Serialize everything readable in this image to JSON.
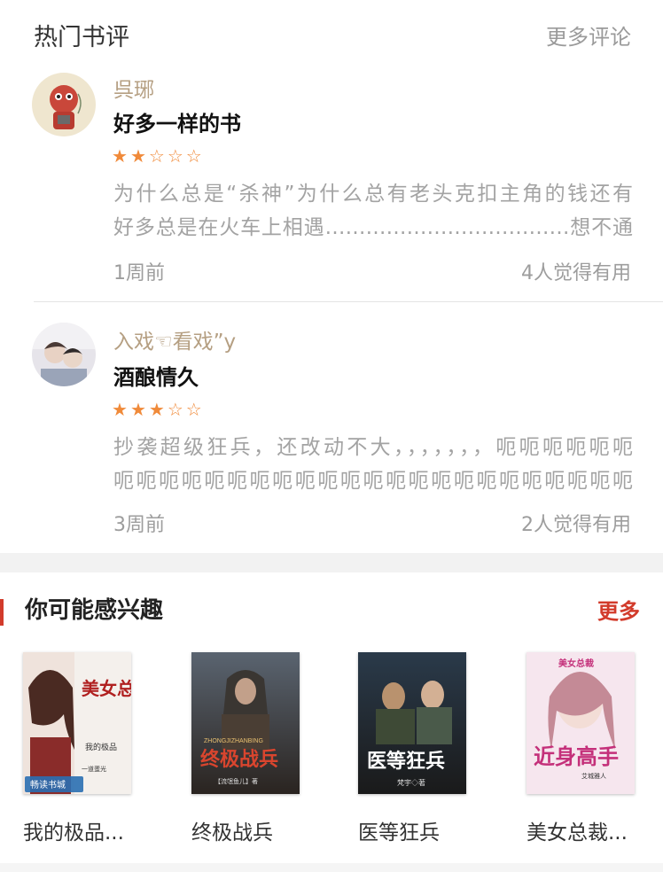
{
  "reviews_section": {
    "title": "热门书评",
    "more_label": "更多评论",
    "items": [
      {
        "username": "呉琊",
        "book": "好多一样的书",
        "rating": 2,
        "max_rating": 5,
        "text_lines": [
          "为什么总是“杀神”为什么总有老头克扣主角的钱还有",
          "好多总是在火车上相遇………………………………想不通"
        ],
        "time": "1周前",
        "helpful": "4人觉得有用"
      },
      {
        "username": "入戏☜看戏”y",
        "book": "酒酿情久",
        "rating": 3,
        "max_rating": 5,
        "text_lines": [
          "抄袭超级狂兵，还改动不大，，，，，，，呃呃呃呃呃呃",
          "呃呃呃呃呃呃呃呃呃呃呃呃呃呃呃呃呃呃呃呃呃呃呃"
        ],
        "time": "3周前",
        "helpful": "2人觉得有用"
      }
    ]
  },
  "recommend_section": {
    "title": "你可能感兴趣",
    "more_label": "更多",
    "books": [
      {
        "title": "我的极品...",
        "cover_text": "美女总裁",
        "cover_sub": "我的极品",
        "cover_badge": "畅读书城",
        "cover_author": "一道蛋光"
      },
      {
        "title": "终极战兵",
        "cover_text": "终极战兵",
        "cover_sub": "ZHONGJIZHANBING",
        "cover_author": "【流氓鱼儿】著"
      },
      {
        "title": "医等狂兵",
        "cover_text": "医等狂兵",
        "cover_author": "梵宇◇著"
      },
      {
        "title": "美女总裁...",
        "cover_text": "近身高手",
        "cover_sub": "美女总裁",
        "cover_author": "艾城雅人"
      }
    ]
  },
  "colors": {
    "accent_red": "#d23b2b",
    "star_orange": "#f08a3a",
    "username_tan": "#b59f82"
  }
}
